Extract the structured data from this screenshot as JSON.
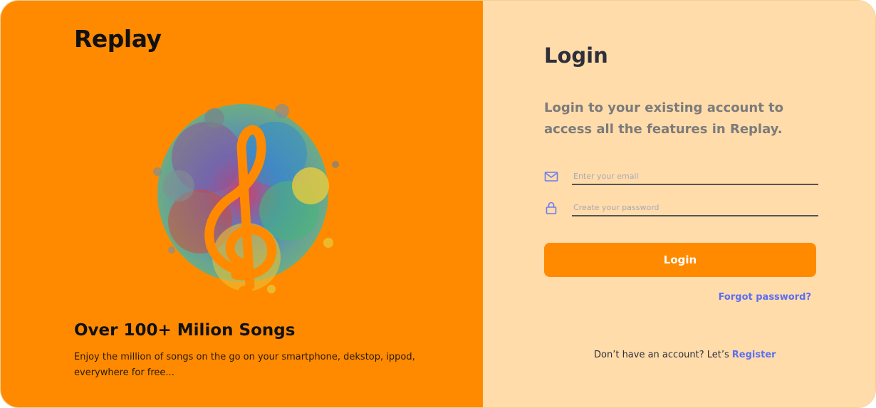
{
  "brand": {
    "name": "Replay"
  },
  "promo": {
    "title": "Over 100+ Milion Songs",
    "text": "Enjoy the million of songs on the go on your smartphone, dekstop, ippod, everywhere for free..."
  },
  "login": {
    "title": "Login",
    "subtitle": "Login to your existing account to access all the features in Replay.",
    "email_placeholder": "Enter your email",
    "password_placeholder": "Create your password",
    "button_label": "Login",
    "forgot_label": "Forgot password?",
    "register_prompt": "Don’t have an account? Let’s",
    "register_label": "Register"
  },
  "icons": {
    "hero": "music-note-icon",
    "email": "mail-icon",
    "password": "lock-icon"
  },
  "colors": {
    "accent": "#ff8a00",
    "panel": "#ffdcaa",
    "link": "#5b6ef5",
    "field_icon": "#6b7bf2"
  }
}
